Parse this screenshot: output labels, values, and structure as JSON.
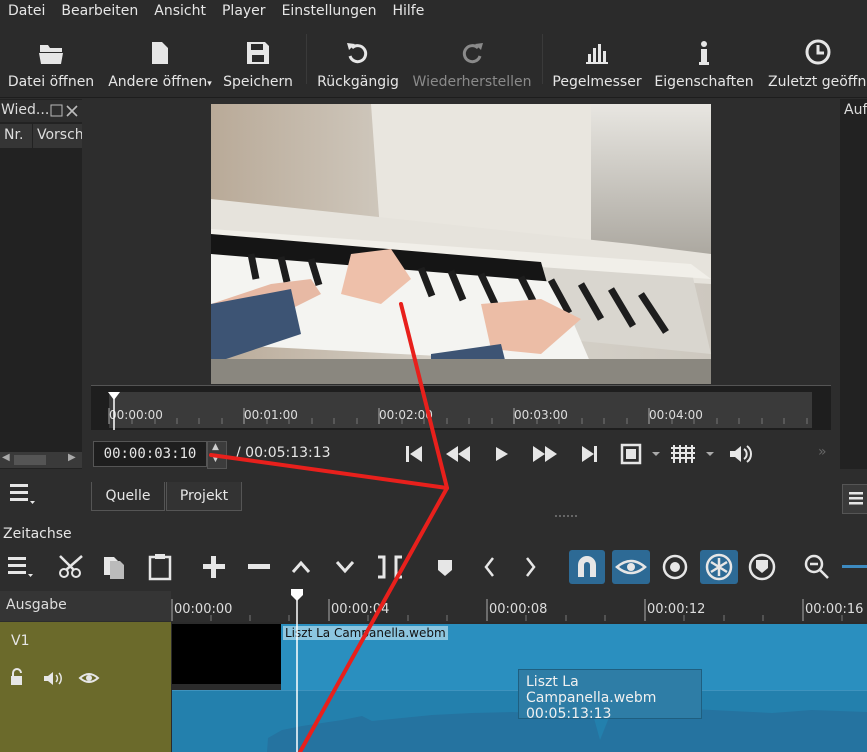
{
  "menu": {
    "items": [
      "Datei",
      "Bearbeiten",
      "Ansicht",
      "Player",
      "Einstellungen",
      "Hilfe"
    ]
  },
  "toolbar": {
    "open_file": "Datei öffnen",
    "open_other": "Andere öffnen",
    "save": "Speichern",
    "undo": "Rückgängig",
    "redo": "Wiederherstellen",
    "meter": "Pegelmesser",
    "properties": "Eigenschaften",
    "recent": "Zuletzt geöffne"
  },
  "left_panel": {
    "title": "Wied...",
    "col_nr": "Nr.",
    "col_preview": "Vorsch"
  },
  "right_panel": {
    "title": "Auf"
  },
  "player": {
    "ruler_ticks": [
      "00:00:00",
      "00:01:00",
      "00:02:00",
      "00:03:00",
      "00:04:00"
    ],
    "current_time": "00:00:03:10",
    "duration": "/ 00:05:13:13",
    "tab_source": "Quelle",
    "tab_project": "Projekt"
  },
  "timeline": {
    "title": "Zeitachse",
    "output_label": "Ausgabe",
    "track_name": "V1",
    "ruler_ticks": [
      "00:00:00",
      "00:00:04",
      "00:00:08",
      "00:00:12",
      "00:00:16"
    ],
    "clip_name": "Liszt La Campanella.webm",
    "tooltip_name": "Liszt La Campanella.webm",
    "tooltip_duration": "00:05:13:13"
  },
  "colors": {
    "clip": "#2a8fbf",
    "track_head": "#6b6a2b",
    "annotation": "#e8201c"
  }
}
